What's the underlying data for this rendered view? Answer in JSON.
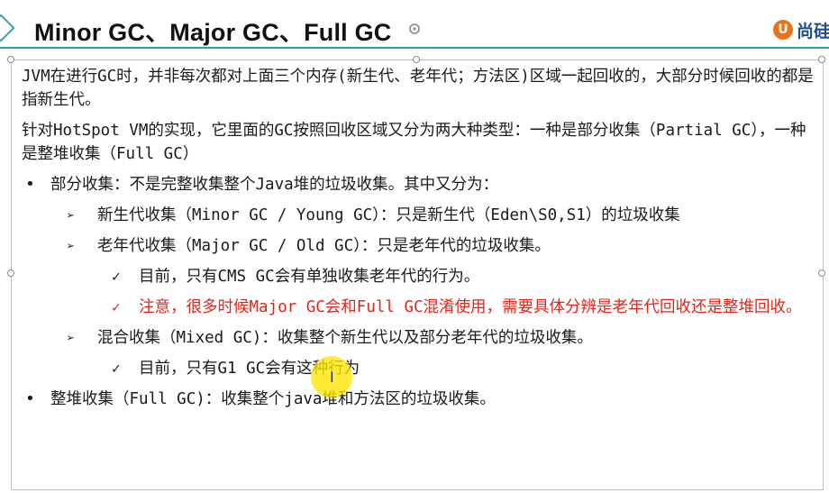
{
  "slide": {
    "title": "Minor GC、Major GC、Full GC",
    "logo_text": "尚硅",
    "logo_mark": "U"
  },
  "content": {
    "p1": "JVM在进行GC时，并非每次都对上面三个内存(新生代、老年代；方法区)区域一起回收的，大部分时候回收的都是指新生代。",
    "p2": "针对HotSpot VM的实现，它里面的GC按照回收区域又分为两大种类型：一种是部分收集（Partial GC），一种是整堆收集（Full GC）",
    "b1": "部分收集：不是完整收集整个Java堆的垃圾收集。其中又分为：",
    "b1_1": "新生代收集（Minor GC / Young GC）：只是新生代（Eden\\S0,S1）的垃圾收集",
    "b1_2": "老年代收集（Major GC / Old GC）：只是老年代的垃圾收集。",
    "b1_2_1": "目前，只有CMS GC会有单独收集老年代的行为。",
    "b1_2_2": "注意，很多时候Major GC会和Full GC混淆使用，需要具体分辨是老年代回收还是整堆回收。",
    "b1_3": "混合收集（Mixed GC)：收集整个新生代以及部分老年代的垃圾收集。",
    "b1_3_1": "目前，只有G1 GC会有这种行为",
    "b2": "整堆收集（Full GC)：收集整个java堆和方法区的垃圾收集。"
  },
  "symbols": {
    "dot": "•",
    "arrow": "➢",
    "check": "✓",
    "cursor": "I"
  },
  "colors": {
    "accent": "#2e9fae",
    "warning_text": "#e1251b",
    "logo_orange": "#e9731c",
    "logo_blue": "#1f4e8c",
    "pointer_highlight": "#ffe600"
  }
}
